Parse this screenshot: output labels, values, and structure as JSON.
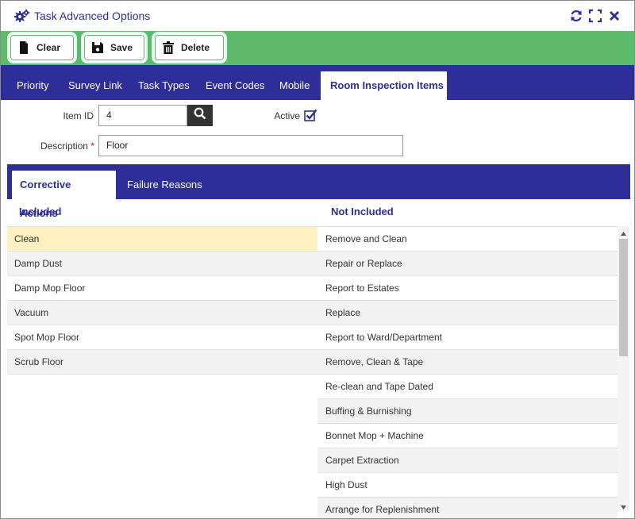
{
  "window": {
    "title": "Task Advanced Options"
  },
  "toolbar": {
    "clear_label": "Clear",
    "save_label": "Save",
    "delete_label": "Delete"
  },
  "main_tabs": [
    {
      "label": "Priority"
    },
    {
      "label": "Survey Link"
    },
    {
      "label": "Task Types"
    },
    {
      "label": "Event Codes"
    },
    {
      "label": "Mobile"
    },
    {
      "label": "Room Inspection Items",
      "active": true
    }
  ],
  "form": {
    "item_id_label": "Item ID",
    "item_id_value": "4",
    "active_label": "Active",
    "active_checked": true,
    "description_label": "Description",
    "description_required": "*",
    "description_value": "Floor"
  },
  "sub_tabs": [
    {
      "label": "Corrective Actions",
      "active": true
    },
    {
      "label": "Failure Reasons"
    }
  ],
  "lists": {
    "included_header": "Included",
    "not_included_header": "Not Included",
    "included": [
      "Clean",
      "Damp Dust",
      "Damp Mop Floor",
      "Vacuum",
      "Spot Mop Floor",
      "Scrub Floor"
    ],
    "not_included": [
      "Remove and Clean",
      "Repair or Replace",
      "Report to Estates",
      "Replace",
      "Report to Ward/Department",
      "Remove, Clean & Tape",
      "Re-clean and Tape Dated",
      "Buffing & Burnishing",
      "Bonnet Mop + Machine",
      "Carpet Extraction",
      "High Dust",
      "Arrange for Replenishment"
    ]
  },
  "colors": {
    "accent_blue": "#2e2e9a",
    "toolbar_green": "#5cba6b",
    "selected_row": "#fff0c2"
  }
}
